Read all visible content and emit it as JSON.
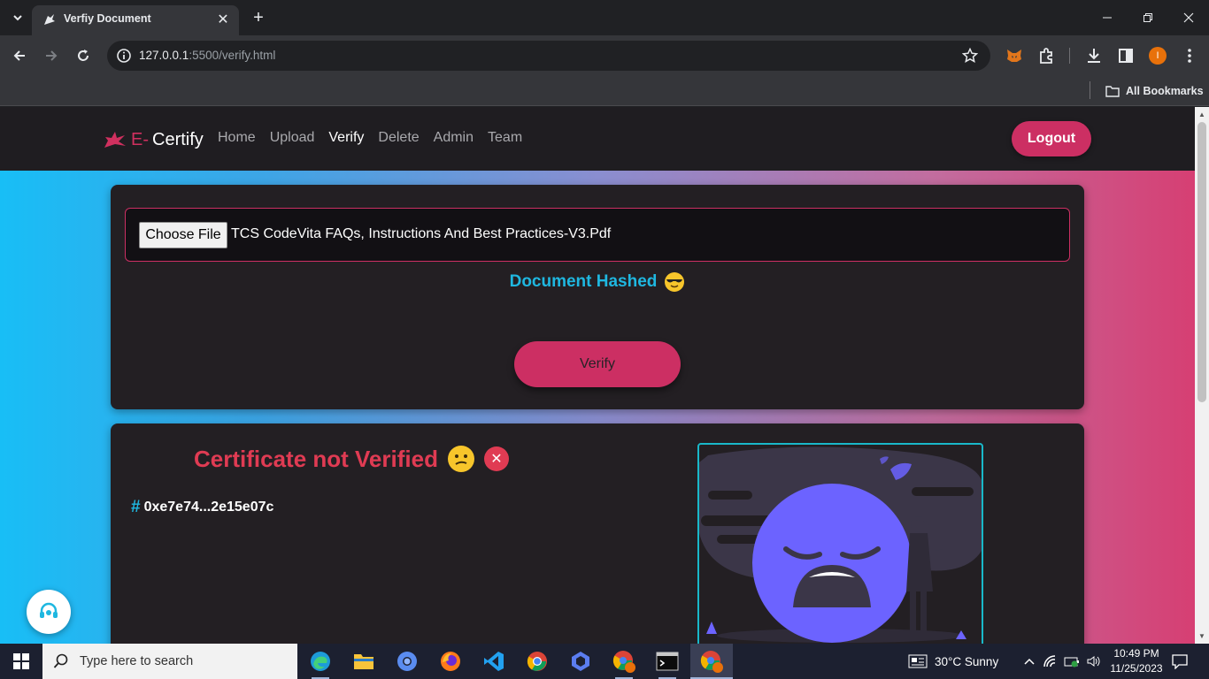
{
  "browser": {
    "tab_title": "Verfiy Document",
    "url_host": "127.0.0.1",
    "url_path": ":5500/verify.html",
    "bookmarks_label": "All Bookmarks",
    "profile_initial": "I"
  },
  "site": {
    "brand_prefix": "E-",
    "brand_name": "Certify",
    "nav": [
      {
        "label": "Home",
        "active": false
      },
      {
        "label": "Upload",
        "active": false
      },
      {
        "label": "Verify",
        "active": true
      },
      {
        "label": "Delete",
        "active": false
      },
      {
        "label": "Admin",
        "active": false
      },
      {
        "label": "Team",
        "active": false
      }
    ],
    "logout_label": "Logout"
  },
  "upload": {
    "choose_file_label": "Choose File",
    "file_name": "TCS CodeVita FAQs, Instructions And Best Practices-V3.Pdf",
    "status_text": "Document Hashed",
    "status_emoji": "cool-face-icon",
    "verify_label": "Verify"
  },
  "result": {
    "title": "Certificate not Verified",
    "hash_symbol": "#",
    "hash": "0xe7e74...2e15e07c"
  },
  "taskbar": {
    "search_placeholder": "Type here to search",
    "weather": "30°C  Sunny",
    "time": "10:49 PM",
    "date": "11/25/2023"
  },
  "colors": {
    "accent": "#cc2f63",
    "cyan": "#1fb7e0",
    "error": "#e03b53",
    "card_bg": "#231f23"
  }
}
